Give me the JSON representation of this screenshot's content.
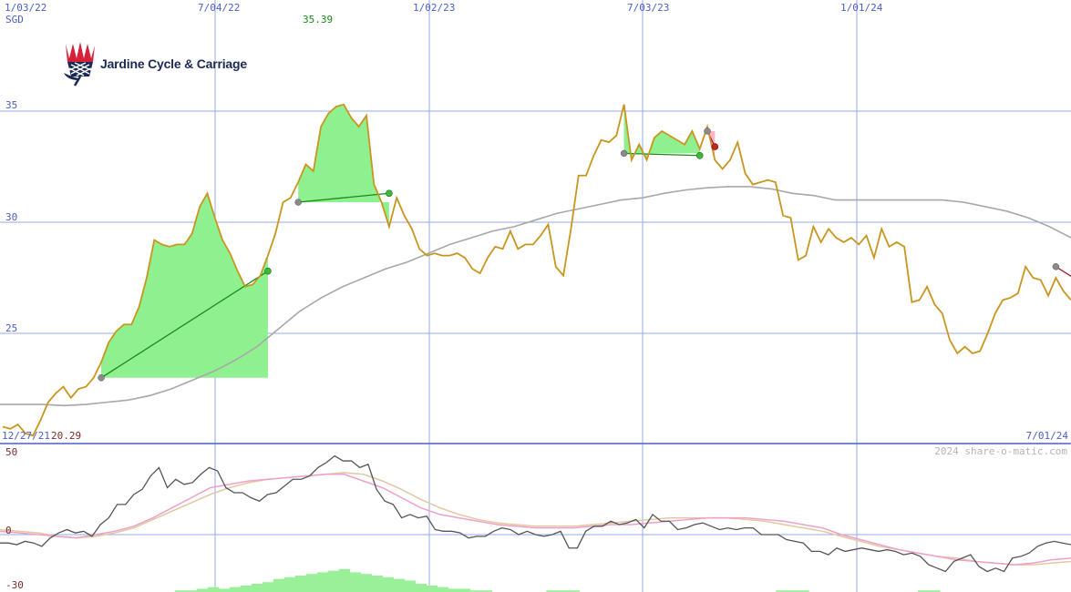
{
  "company": "Jardine Cycle & Carriage",
  "currency": "SGD",
  "watermark": "2024 share-o-matic.com",
  "colors": {
    "price": "#c8961e",
    "ma": "#a8a8a8",
    "gain_fill": "#8ff08f",
    "loss_fill": "#f7b3c8",
    "grid": "#9aa8e8",
    "osc": "#555555",
    "osc_pink": "#f0a0c8",
    "osc_tan": "#e0c8a0",
    "volume": "#99f099"
  },
  "chart_data": [
    {
      "type": "line",
      "title": "",
      "ylabel": "SGD",
      "x_tick_labels": [
        "1/03/22",
        "7/04/22",
        "1/02/23",
        "7/03/23",
        "1/01/24"
      ],
      "y_tick_labels": [
        "35",
        "30",
        "25"
      ],
      "ylim": [
        20,
        38.5
      ],
      "high_label": "35.39",
      "low_label": "20.29",
      "start_date_label": "12/27/21",
      "end_date_label": "7/01/24",
      "grid": true,
      "series": [
        {
          "values": [
            20.8,
            20.7,
            20.9,
            20.5,
            20.4,
            21.1,
            21.9,
            22.3,
            22.6,
            22.1,
            22.5,
            22.6,
            23.0,
            23.7,
            24.6,
            25.1,
            25.4,
            25.4,
            26.2,
            27.5,
            29.2,
            29.0,
            28.9,
            29.0,
            29.0,
            29.5,
            30.7,
            31.3,
            30.2,
            29.2,
            28.6,
            27.8,
            27.1,
            27.2,
            27.6,
            28.5,
            29.5,
            30.9,
            31.1,
            31.8,
            32.6,
            32.3,
            34.3,
            34.9,
            35.2,
            35.3,
            34.7,
            34.3,
            34.8,
            31.7,
            30.9,
            29.8,
            31.1,
            30.3,
            29.7,
            28.8,
            28.5,
            28.6,
            28.5,
            28.5,
            28.6,
            28.4,
            27.9,
            27.7,
            28.4,
            28.9,
            28.8,
            29.6,
            28.8,
            29.0,
            29.0,
            29.4,
            29.9,
            28.0,
            27.6,
            29.7,
            32.1,
            32.1,
            33.0,
            33.7,
            33.6,
            33.9,
            35.3,
            32.8,
            33.5,
            32.8,
            33.8,
            34.1,
            33.9,
            33.7,
            33.5,
            34.1,
            33.3,
            34.3,
            32.8,
            32.4,
            32.8,
            33.6,
            32.2,
            31.7,
            31.8,
            31.9,
            31.8,
            30.3,
            30.2,
            28.3,
            28.5,
            29.8,
            29.1,
            29.7,
            29.3,
            29.1,
            29.3,
            29.0,
            29.4,
            28.4,
            29.7,
            28.9,
            29.1,
            28.9,
            26.4,
            26.5,
            27.1,
            26.3,
            25.9,
            24.7,
            24.1,
            24.4,
            24.1,
            24.2,
            25.0,
            25.9,
            26.5,
            26.6,
            26.8,
            28.0,
            27.5,
            27.4,
            26.7,
            27.5,
            26.9,
            26.5
          ],
          "start_y": 20.8
        },
        {
          "name": "",
          "values": [
            21.8,
            21.8,
            21.8,
            21.75,
            21.8,
            21.9,
            22.0,
            22.2,
            22.5,
            22.9,
            23.3,
            23.8,
            24.4,
            25.2,
            26.0,
            26.6,
            27.1,
            27.5,
            27.9,
            28.2,
            28.6,
            29.0,
            29.3,
            29.6,
            29.8,
            30.1,
            30.4,
            30.6,
            30.8,
            31.0,
            31.1,
            31.3,
            31.45,
            31.55,
            31.6,
            31.6,
            31.5,
            31.3,
            31.2,
            31.0,
            31.0,
            31.0,
            31.0,
            31.0,
            31.0,
            30.9,
            30.7,
            30.5,
            30.2,
            29.8,
            29.3
          ]
        }
      ],
      "annotations": [
        {
          "kind": "gain",
          "from": {
            "x": 13,
            "y": 23.0
          },
          "to": {
            "x": 35,
            "y": 27.8
          }
        },
        {
          "kind": "gain",
          "from": {
            "x": 39,
            "y": 30.9
          },
          "to": {
            "x": 51,
            "y": 31.3
          }
        },
        {
          "kind": "gain",
          "from": {
            "x": 82,
            "y": 33.1
          },
          "to": {
            "x": 92,
            "y": 33.0
          }
        },
        {
          "kind": "loss",
          "from": {
            "x": 93,
            "y": 34.1
          },
          "to": {
            "x": 94,
            "y": 33.4
          }
        },
        {
          "kind": "loss",
          "from": {
            "x": 139,
            "y": 28.0
          },
          "to": {
            "x": 146,
            "y": 26.5
          }
        }
      ]
    },
    {
      "type": "line",
      "title": "",
      "y_tick_labels": [
        "50",
        "0",
        "-30"
      ],
      "ylim": [
        -30,
        50
      ],
      "series": [
        {
          "values": [
            -5,
            -5,
            -6,
            -4,
            -5,
            -7,
            -2,
            1,
            3,
            1,
            2,
            -1,
            6,
            10,
            18,
            18,
            24,
            27,
            35,
            40,
            28,
            33,
            30,
            31,
            36,
            40,
            38,
            28,
            25,
            25,
            22,
            20,
            24,
            25,
            29,
            33,
            33,
            35,
            40,
            43,
            47,
            44,
            44,
            40,
            42,
            27,
            20,
            18,
            10,
            12,
            10,
            11,
            3,
            2,
            2,
            1,
            -2,
            -1,
            -1,
            2,
            4,
            3,
            0,
            2,
            0,
            -1,
            0,
            2,
            -8,
            -8,
            2,
            5,
            5,
            8,
            6,
            7,
            9,
            4,
            12,
            8,
            8,
            3,
            4,
            6,
            7,
            5,
            3,
            4,
            3,
            4,
            4,
            0,
            0,
            0,
            -3,
            -4,
            -5,
            -10,
            -10,
            -12,
            -8,
            -10,
            -9,
            -8,
            -9,
            -10,
            -9,
            -10,
            -12,
            -11,
            -13,
            -18,
            -20,
            -22,
            -16,
            -14,
            -12,
            -19,
            -22,
            -20,
            -22,
            -14,
            -13,
            -11,
            -7,
            -5,
            -4,
            -5,
            -6
          ]
        },
        {
          "values": [
            2,
            1,
            0,
            -1,
            -2,
            0,
            2,
            5,
            10,
            16,
            22,
            28,
            30,
            32,
            33,
            34,
            35,
            36,
            36,
            32,
            28,
            22,
            16,
            12,
            10,
            8,
            6,
            5,
            4,
            4,
            4,
            5,
            6,
            6,
            7,
            8,
            9,
            10,
            10,
            10,
            9,
            8,
            6,
            4,
            0,
            -3,
            -6,
            -9,
            -11,
            -13,
            -15,
            -16,
            -17,
            -18,
            -17,
            -15,
            -14
          ]
        },
        {
          "values": [
            3,
            2,
            1,
            -1,
            -2,
            -1,
            1,
            4,
            9,
            14,
            19,
            24,
            28,
            31,
            33,
            34,
            35,
            36,
            37,
            36,
            32,
            27,
            21,
            16,
            12,
            9,
            7,
            6,
            5,
            5,
            5,
            6,
            7,
            8,
            9,
            10,
            10,
            10,
            10,
            9,
            8,
            6,
            4,
            2,
            -1,
            -4,
            -7,
            -9,
            -11,
            -13,
            -14,
            -16,
            -17,
            -18,
            -18,
            -17,
            -16
          ]
        }
      ]
    }
  ]
}
